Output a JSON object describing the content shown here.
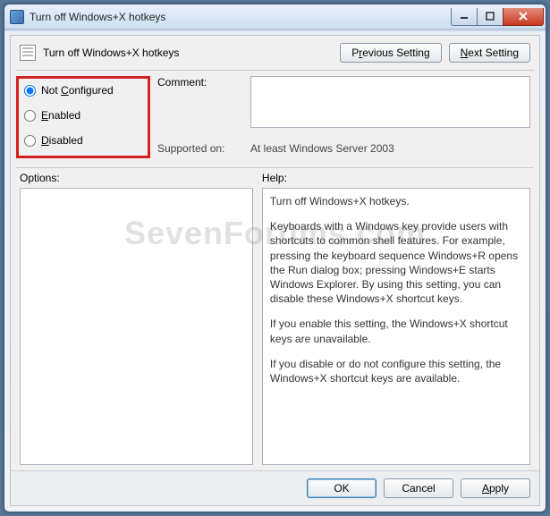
{
  "window": {
    "title": "Turn off Windows+X hotkeys"
  },
  "header": {
    "policy_title": "Turn off Windows+X hotkeys",
    "prev_pre": "P",
    "prev_u": "r",
    "prev_post": "evious Setting",
    "next_u": "N",
    "next_post": "ext Setting"
  },
  "state": {
    "not_configured_u": "C",
    "not_configured_pre": "Not ",
    "not_configured_post": "onfigured",
    "enabled_u": "E",
    "enabled_post": "nabled",
    "disabled_u": "D",
    "disabled_post": "isabled",
    "selected": "not_configured"
  },
  "comment": {
    "label": "Comment:",
    "value": ""
  },
  "supported": {
    "label": "Supported on:",
    "value": "At least Windows Server 2003"
  },
  "options": {
    "label": "Options:"
  },
  "help": {
    "label": "Help:",
    "p1": "Turn off Windows+X hotkeys.",
    "p2": "Keyboards with a Windows key provide users with shortcuts to common shell features. For example, pressing the keyboard sequence Windows+R opens the Run dialog box; pressing Windows+E starts Windows Explorer. By using this setting, you can disable these Windows+X shortcut keys.",
    "p3": "If you enable this setting, the Windows+X shortcut keys are unavailable.",
    "p4": "If you disable or do not configure this setting, the Windows+X shortcut keys are available."
  },
  "buttons": {
    "ok": "OK",
    "cancel": "Cancel",
    "apply_u": "A",
    "apply_post": "pply"
  },
  "watermark": "SevenForums.com"
}
